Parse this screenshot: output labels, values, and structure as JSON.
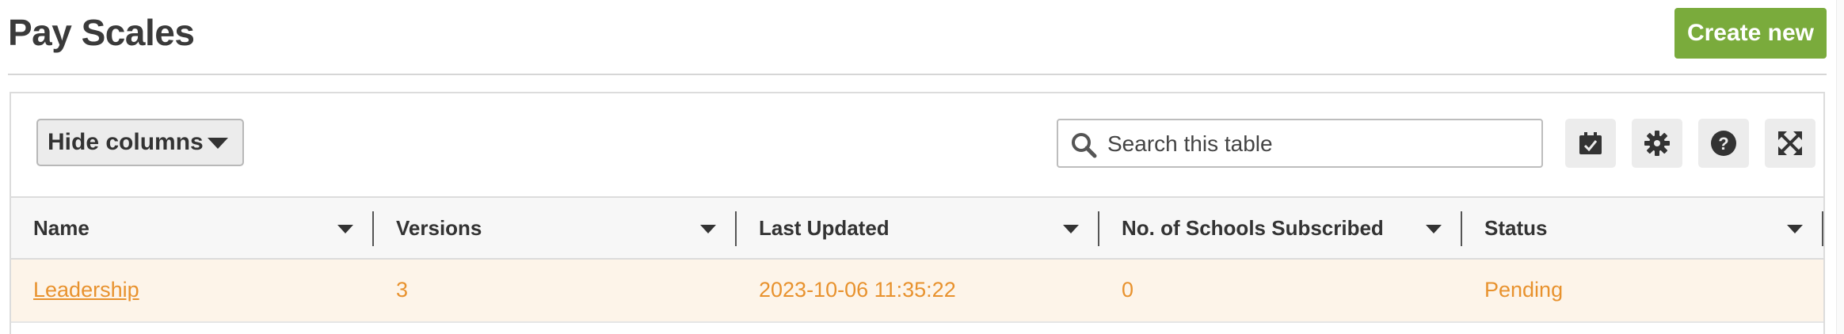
{
  "page": {
    "title": "Pay Scales"
  },
  "header": {
    "create_label": "Create new"
  },
  "toolbar": {
    "hide_columns_label": "Hide columns",
    "search": {
      "placeholder": "Search this table",
      "value": ""
    },
    "icons": [
      "checklist-icon",
      "gear-icon",
      "help-icon",
      "fullscreen-icon"
    ]
  },
  "table": {
    "columns": [
      {
        "label": "Name"
      },
      {
        "label": "Versions"
      },
      {
        "label": "Last Updated"
      },
      {
        "label": "No. of Schools Subscribed"
      },
      {
        "label": "Status"
      }
    ],
    "rows": [
      {
        "name": "Leadership",
        "versions": "3",
        "last_updated": "2023-10-06 11:35:22",
        "schools": "0",
        "status": "Pending"
      }
    ]
  },
  "colors": {
    "accent_green": "#7aab3c",
    "row_text_orange": "#e8922e",
    "row_highlight": "#fdf4e9"
  }
}
